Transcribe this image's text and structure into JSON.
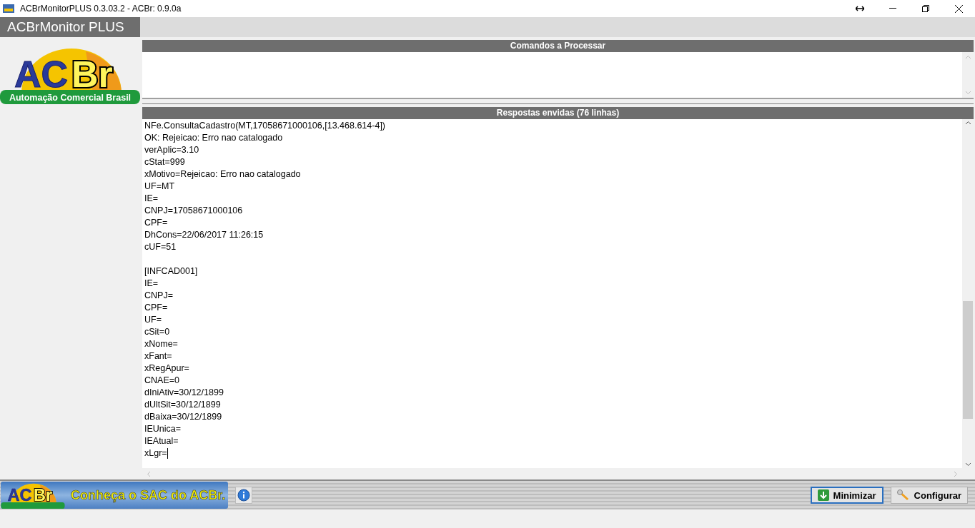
{
  "window": {
    "title": "ACBrMonitorPLUS 0.3.03.2 - ACBr: 0.9.0a"
  },
  "app_title": "ACBrMonitor PLUS",
  "logo": {
    "letters": "AC",
    "letters_2": "Br",
    "tagline": "Automação Comercial Brasil"
  },
  "commands_panel": {
    "title": "Comandos a Processar"
  },
  "responses_panel": {
    "title": "Respostas envidas (76 linhas)",
    "blocks": [
      [
        "NFe.ConsultaCadastro(MT,17058671000106,[13.468.614-4])",
        "OK: Rejeicao: Erro nao catalogado",
        "verAplic=3.10",
        "cStat=999",
        "xMotivo=Rejeicao: Erro nao catalogado",
        "UF=MT",
        "IE=",
        "CNPJ=17058671000106",
        "CPF=",
        "DhCons=22/06/2017 11:26:15",
        "cUF=51"
      ],
      [
        "[INFCAD001]",
        "IE=",
        "CNPJ=",
        "CPF=",
        "UF=",
        "cSit=0",
        "xNome=",
        "xFant=",
        "xRegApur=",
        "CNAE=0",
        "dIniAtiv=30/12/1899",
        "dUltSit=30/12/1899",
        "dBaixa=30/12/1899",
        "IEUnica=",
        "IEAtual=",
        "xLgr="
      ]
    ]
  },
  "banner": {
    "logo_letters": "AC",
    "logo_letters_2": "Br",
    "text": "Conheça o SAC do ACBr."
  },
  "buttons": [
    {
      "label": "Minimizar",
      "kind": "minimize",
      "focused": true
    },
    {
      "label": "Configurar",
      "kind": "configure",
      "focused": false
    }
  ]
}
